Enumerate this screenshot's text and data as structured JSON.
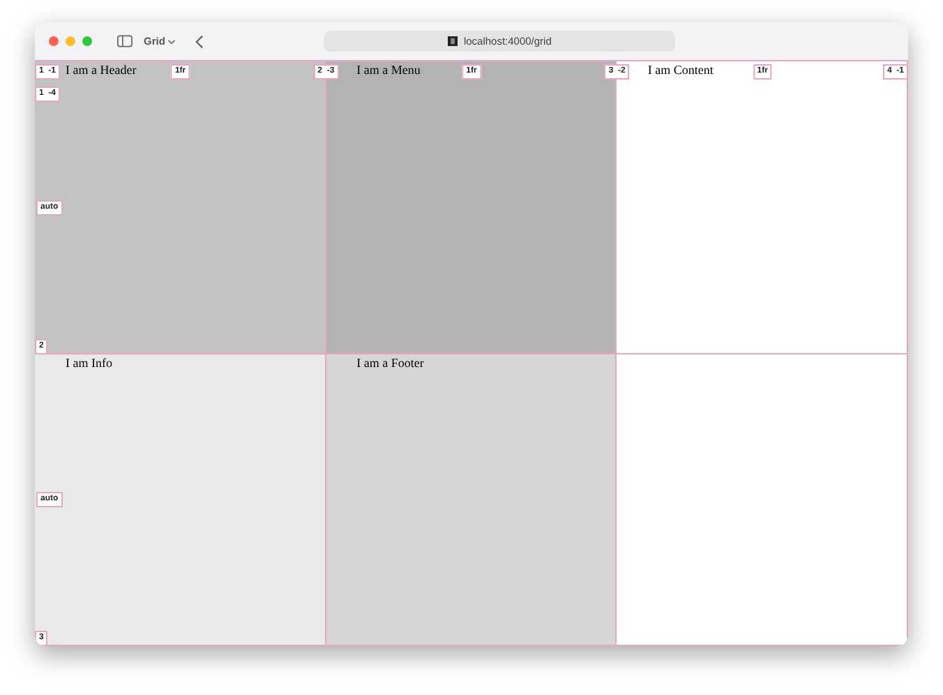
{
  "toolbar": {
    "sidebar_label": "Grid",
    "url": "localhost:4000/grid"
  },
  "cells": [
    {
      "text": "I am a Header",
      "kind": "header"
    },
    {
      "text": "I am a Menu",
      "kind": "menu"
    },
    {
      "text": "I am Content",
      "kind": "content"
    },
    {
      "text": "I am Info",
      "kind": "info"
    },
    {
      "text": "I am a Footer",
      "kind": "footer"
    },
    {
      "kind": "empty"
    }
  ],
  "column_lines": [
    {
      "number": "1",
      "negative": "-1"
    },
    {
      "number": "2",
      "negative": "-3"
    },
    {
      "number": "3",
      "negative": "-2"
    },
    {
      "number": "4",
      "negative": "-1"
    }
  ],
  "column_sizes": [
    "1fr",
    "1fr",
    "1fr"
  ],
  "row_lines": [
    {
      "number": "1",
      "negative": "-4"
    },
    {
      "number": "2"
    },
    {
      "number": "3"
    }
  ],
  "row_sizes": [
    "auto",
    "auto"
  ]
}
